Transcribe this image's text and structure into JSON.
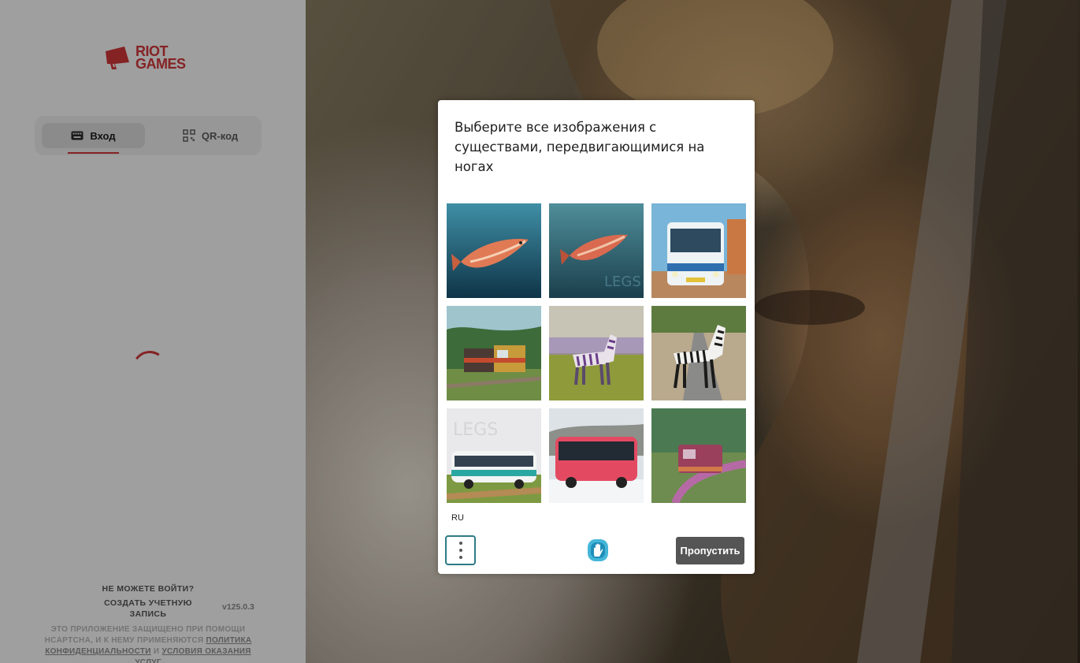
{
  "brand": {
    "logo_line1": "RIOT",
    "logo_line2": "GAMES",
    "accent": "#d13639"
  },
  "tabs": [
    {
      "label": "Вход",
      "icon": "keyboard-icon"
    },
    {
      "label": "QR-код",
      "icon": "qr-code-icon"
    }
  ],
  "footer": {
    "cant_login": "НЕ МОЖЕТЕ ВОЙТИ?",
    "create_account": "СОЗДАТЬ УЧЕТНУЮ ЗАПИСЬ",
    "version": "v125.0.3",
    "legal_text": "ЭТО ПРИЛОЖЕНИЕ ЗАЩИЩЕНО ПРИ ПОМОЩИ HCAPTCHA, И К НЕМУ ПРИМЕНЯЮТСЯ",
    "privacy_link": "ПОЛИТИКА КОНФИДЕНЦИАЛЬНОСТИ",
    "and_text": "И",
    "terms_link": "УСЛОВИЯ ОКАЗАНИЯ УСЛУГ"
  },
  "captcha": {
    "prompt": "Выберите все изображения с существами, передвигающимися на ногах",
    "tiles": [
      {
        "subject": "fish underwater"
      },
      {
        "subject": "fish underwater"
      },
      {
        "subject": "bus"
      },
      {
        "subject": "train"
      },
      {
        "subject": "zebra"
      },
      {
        "subject": "zebra"
      },
      {
        "subject": "bus"
      },
      {
        "subject": "bus"
      },
      {
        "subject": "train"
      }
    ],
    "language": "RU",
    "skip_label": "Пропустить",
    "menu_icon": "kebab-menu-icon",
    "logo_icon": "hcaptcha-logo-icon"
  }
}
